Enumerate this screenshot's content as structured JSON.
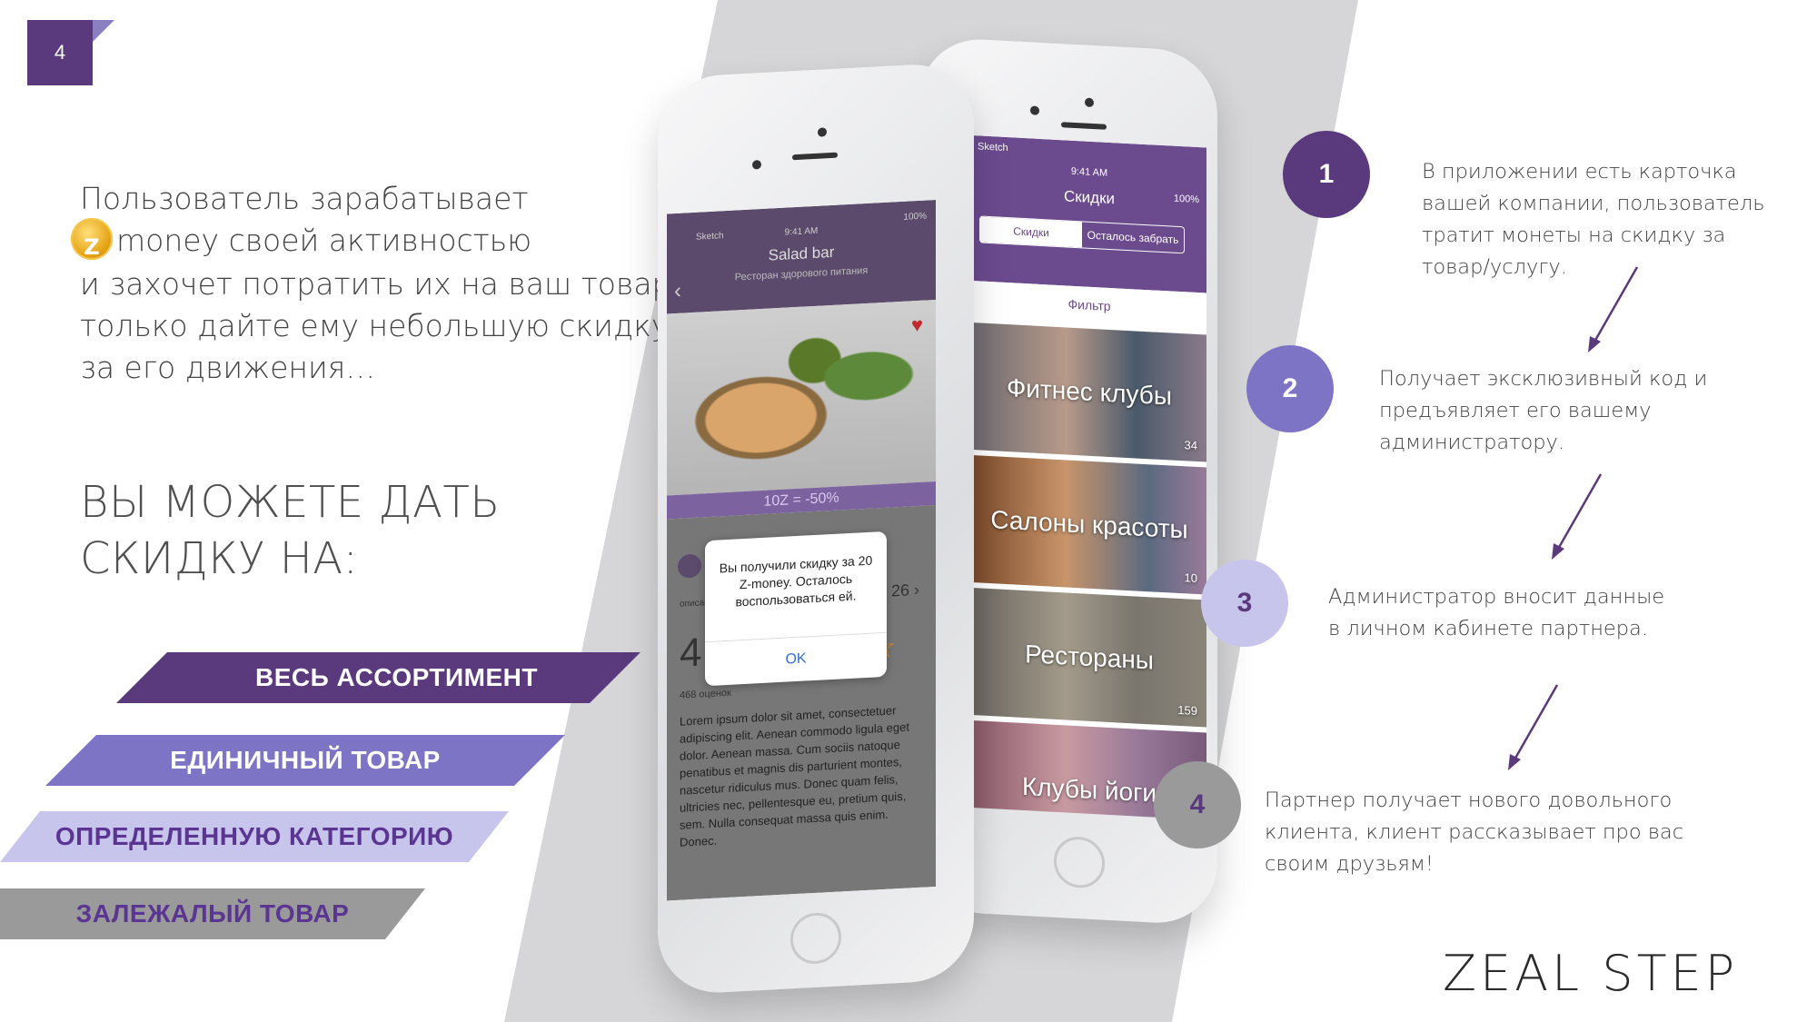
{
  "slide": {
    "number": "4"
  },
  "intro": {
    "line1": "Пользователь зарабатывает",
    "line2": "money своей активностью",
    "line3": "и захочет потратить их на ваш товар,",
    "line4": "только дайте ему небольшую скидку",
    "line5": "за его движения…"
  },
  "headline": {
    "line1": "ВЫ МОЖЕТЕ ДАТЬ",
    "line2": "СКИДКУ НА:"
  },
  "options": [
    "ВЕСЬ АССОРТИМЕНТ",
    "ЕДИНИЧНЫЙ ТОВАР",
    "ОПРЕДЕЛЕННУЮ КАТЕГОРИЮ",
    "ЗАЛЕЖАЛЫЙ ТОВАР"
  ],
  "back_phone": {
    "status_carrier": "Sketch",
    "status_time": "9:41 AM",
    "status_battery": "100%",
    "title": "Скидки",
    "tab_active": "Скидки",
    "tab_inactive": "Осталось забрать",
    "filter": "Фильтр",
    "categories": [
      {
        "name": "Фитнес клубы",
        "count": "34"
      },
      {
        "name": "Салоны красоты",
        "count": "10"
      },
      {
        "name": "Рестораны",
        "count": "159"
      },
      {
        "name": "Клубы йоги",
        "count": ""
      }
    ]
  },
  "front_phone": {
    "status_carrier": "Sketch",
    "status_time": "9:41 AM",
    "status_battery": "100%",
    "title": "Salad bar",
    "subtitle": "Ресторан здорового питания",
    "discount": "10Z = -50%",
    "count": "26",
    "info_label": "описание",
    "rating": "4.7",
    "stars": "★★★★☆",
    "reviews": "468 оценок",
    "lorem": "Lorem ipsum dolor sit amet, consectetuer adipiscing elit. Aenean commodo ligula eget dolor. Aenean massa. Cum sociis natoque penatibus et magnis dis parturient montes, nascetur ridiculus mus. Donec quam felis, ultricies nec, pellentesque eu, pretium quis, sem. Nulla consequat massa quis enim. Donec.",
    "dialog_message": "Вы получили скидку за 20 Z-money. Осталось воспользоваться ей.",
    "dialog_ok": "OK"
  },
  "steps": [
    {
      "number": "1",
      "lines": [
        "В приложении есть карточка",
        "вашей компании, пользователь",
        "тратит монеты на скидку за",
        "товар/услугу."
      ]
    },
    {
      "number": "2",
      "lines": [
        "Получает эксклюзивный код и",
        "предъявляет его вашему",
        "администратору."
      ]
    },
    {
      "number": "3",
      "lines": [
        "Администратор вносит данные",
        "в личном кабинете партнера."
      ]
    },
    {
      "number": "4",
      "lines": [
        "Партнер получает нового довольного",
        "клиента, клиент рассказывает про вас",
        "своим друзьям!"
      ]
    }
  ],
  "brand": "ZEAL STEP",
  "colors": {
    "purple_dark": "#5a3a7c",
    "purple_mid": "#7d74c6",
    "purple_light": "#c8c5ec",
    "grey": "#9a9a9a"
  }
}
